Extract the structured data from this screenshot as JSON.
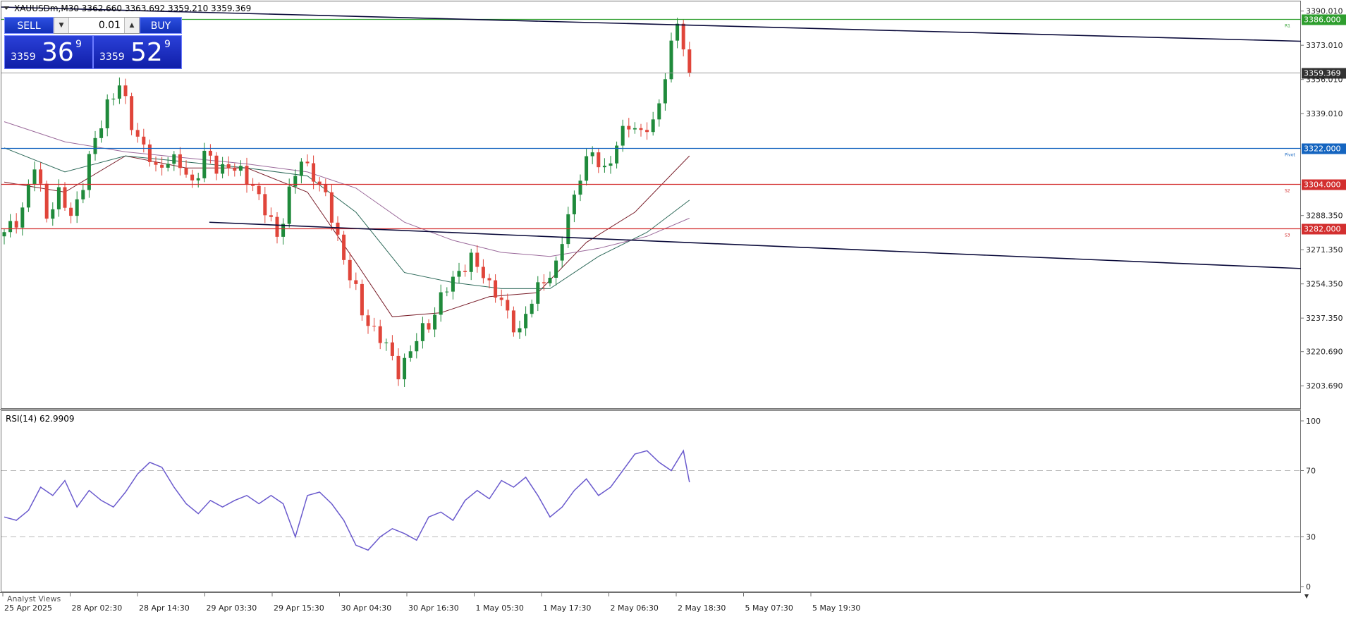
{
  "header": {
    "symbol_info": "XAUUSDm,M30  3362.660 3363.692 3359.210 3359.369",
    "indicator_label": "RSI(14) 62.9909"
  },
  "trade_panel": {
    "sell_label": "SELL",
    "buy_label": "BUY",
    "lot": "0.01",
    "sell_small": "3359",
    "sell_big": "36",
    "sell_sup": "9",
    "buy_small": "3359",
    "buy_big": "52",
    "buy_sup": "9"
  },
  "icons": {
    "dropdown": "triangle-down-icon",
    "step_down": "chevron-down-icon",
    "step_up": "chevron-up-icon"
  },
  "footer_text": "Analyst Views",
  "colors": {
    "bull": "#1f8a3b",
    "bear": "#e0453a",
    "resistance": "#2e9e2e",
    "pivot": "#1565c0",
    "support": "#d32f2f",
    "trendline": "#0a0a3a",
    "rsi": "#6a5acd",
    "current_price": "#333333",
    "ma_fast": "#7a1f2b",
    "ma_mid": "#2e6a5a",
    "ma_slow": "#9b6a9b"
  },
  "chart_data": [
    {
      "type": "candlestick",
      "ylim": [
        3195,
        3392
      ],
      "yticks": [
        "3390.010",
        "3373.010",
        "3356.010",
        "3339.010",
        "3288.350",
        "3271.350",
        "3254.350",
        "3237.350",
        "3220.690",
        "3203.690"
      ],
      "xticks": [
        "25 Apr 2025",
        "28 Apr 02:30",
        "28 Apr 14:30",
        "29 Apr 03:30",
        "29 Apr 15:30",
        "30 Apr 04:30",
        "30 Apr 16:30",
        "1 May 05:30",
        "1 May 17:30",
        "2 May 06:30",
        "2 May 18:30",
        "5 May 07:30",
        "5 May 19:30"
      ],
      "current_price": 3359.369,
      "levels": [
        {
          "label": "3386.000",
          "value": 3386.0,
          "tag": "R1",
          "role": "resistance"
        },
        {
          "label": "3322.000",
          "value": 3322.0,
          "tag": "Pivot",
          "role": "pivot"
        },
        {
          "label": "3304.000",
          "value": 3304.0,
          "tag": "S2",
          "role": "support"
        },
        {
          "label": "3282.000",
          "value": 3282.0,
          "tag": "S3",
          "role": "support"
        }
      ],
      "trendlines": [
        {
          "from": [
            0,
            3392
          ],
          "to": [
            100,
            3375
          ]
        },
        {
          "from": [
            16,
            3285
          ],
          "to": [
            100,
            3262
          ]
        }
      ],
      "close_path": [
        [
          0,
          3278
        ],
        [
          3,
          3292
        ],
        [
          5,
          3312
        ],
        [
          7,
          3290
        ],
        [
          9,
          3298
        ],
        [
          11,
          3288
        ],
        [
          13,
          3305
        ],
        [
          15,
          3325
        ],
        [
          17,
          3345
        ],
        [
          19,
          3352
        ],
        [
          21,
          3335
        ],
        [
          23,
          3322
        ],
        [
          25,
          3310
        ],
        [
          27,
          3318
        ],
        [
          29,
          3312
        ],
        [
          31,
          3305
        ],
        [
          33,
          3318
        ],
        [
          35,
          3312
        ],
        [
          37,
          3314
        ],
        [
          39,
          3308
        ],
        [
          41,
          3305
        ],
        [
          43,
          3290
        ],
        [
          45,
          3278
        ],
        [
          47,
          3300
        ],
        [
          49,
          3315
        ],
        [
          51,
          3310
        ],
        [
          53,
          3296
        ],
        [
          55,
          3278
        ],
        [
          57,
          3258
        ],
        [
          59,
          3240
        ],
        [
          61,
          3232
        ],
        [
          63,
          3222
        ],
        [
          65,
          3212
        ],
        [
          67,
          3220
        ],
        [
          69,
          3232
        ],
        [
          71,
          3240
        ],
        [
          73,
          3252
        ],
        [
          75,
          3262
        ],
        [
          77,
          3265
        ],
        [
          79,
          3260
        ],
        [
          81,
          3250
        ],
        [
          83,
          3238
        ],
        [
          85,
          3232
        ],
        [
          87,
          3245
        ],
        [
          89,
          3258
        ],
        [
          91,
          3262
        ],
        [
          93,
          3288
        ],
        [
          95,
          3310
        ],
        [
          97,
          3318
        ],
        [
          99,
          3312
        ],
        [
          101,
          3322
        ],
        [
          103,
          3335
        ],
        [
          105,
          3330
        ],
        [
          107,
          3332
        ],
        [
          109,
          3360
        ],
        [
          111,
          3384
        ],
        [
          112,
          3370
        ],
        [
          113,
          3359.4
        ]
      ],
      "moving_averages": [
        {
          "name": "MA fast",
          "points": [
            [
              0,
              3305
            ],
            [
              10,
              3300
            ],
            [
              20,
              3318
            ],
            [
              30,
              3312
            ],
            [
              40,
              3312
            ],
            [
              50,
              3300
            ],
            [
              58,
              3265
            ],
            [
              64,
              3238
            ],
            [
              72,
              3240
            ],
            [
              80,
              3248
            ],
            [
              88,
              3250
            ],
            [
              96,
              3275
            ],
            [
              104,
              3290
            ],
            [
              113,
              3318
            ]
          ]
        },
        {
          "name": "MA mid",
          "points": [
            [
              0,
              3322
            ],
            [
              10,
              3310
            ],
            [
              20,
              3318
            ],
            [
              30,
              3315
            ],
            [
              40,
              3312
            ],
            [
              50,
              3308
            ],
            [
              58,
              3290
            ],
            [
              66,
              3260
            ],
            [
              74,
              3255
            ],
            [
              82,
              3252
            ],
            [
              90,
              3252
            ],
            [
              98,
              3268
            ],
            [
              106,
              3280
            ],
            [
              113,
              3296
            ]
          ]
        },
        {
          "name": "MA slow",
          "points": [
            [
              0,
              3335
            ],
            [
              10,
              3325
            ],
            [
              20,
              3320
            ],
            [
              30,
              3317
            ],
            [
              40,
              3314
            ],
            [
              50,
              3310
            ],
            [
              58,
              3302
            ],
            [
              66,
              3285
            ],
            [
              74,
              3276
            ],
            [
              82,
              3270
            ],
            [
              90,
              3268
            ],
            [
              98,
              3272
            ],
            [
              106,
              3278
            ],
            [
              113,
              3287
            ]
          ]
        }
      ]
    },
    {
      "type": "line",
      "series": [
        {
          "name": "RSI(14)",
          "values": [
            [
              0,
              42
            ],
            [
              2,
              40
            ],
            [
              4,
              46
            ],
            [
              6,
              60
            ],
            [
              8,
              55
            ],
            [
              10,
              64
            ],
            [
              12,
              48
            ],
            [
              14,
              58
            ],
            [
              16,
              52
            ],
            [
              18,
              48
            ],
            [
              20,
              57
            ],
            [
              22,
              68
            ],
            [
              24,
              75
            ],
            [
              26,
              72
            ],
            [
              28,
              60
            ],
            [
              30,
              50
            ],
            [
              32,
              44
            ],
            [
              34,
              52
            ],
            [
              36,
              48
            ],
            [
              38,
              52
            ],
            [
              40,
              55
            ],
            [
              42,
              50
            ],
            [
              44,
              55
            ],
            [
              46,
              50
            ],
            [
              48,
              30
            ],
            [
              50,
              55
            ],
            [
              52,
              57
            ],
            [
              54,
              50
            ],
            [
              56,
              40
            ],
            [
              58,
              25
            ],
            [
              60,
              22
            ],
            [
              62,
              30
            ],
            [
              64,
              35
            ],
            [
              66,
              32
            ],
            [
              68,
              28
            ],
            [
              70,
              42
            ],
            [
              72,
              45
            ],
            [
              74,
              40
            ],
            [
              76,
              52
            ],
            [
              78,
              58
            ],
            [
              80,
              53
            ],
            [
              82,
              64
            ],
            [
              84,
              60
            ],
            [
              86,
              66
            ],
            [
              88,
              55
            ],
            [
              90,
              42
            ],
            [
              92,
              48
            ],
            [
              94,
              58
            ],
            [
              96,
              65
            ],
            [
              98,
              55
            ],
            [
              100,
              60
            ],
            [
              102,
              70
            ],
            [
              104,
              80
            ],
            [
              106,
              82
            ],
            [
              108,
              75
            ],
            [
              110,
              70
            ],
            [
              112,
              82
            ],
            [
              113,
              63
            ]
          ]
        }
      ],
      "ylim": [
        0,
        100
      ],
      "yticks": [
        "100",
        "70",
        "30",
        "0"
      ],
      "levels": [
        70,
        30
      ]
    }
  ]
}
